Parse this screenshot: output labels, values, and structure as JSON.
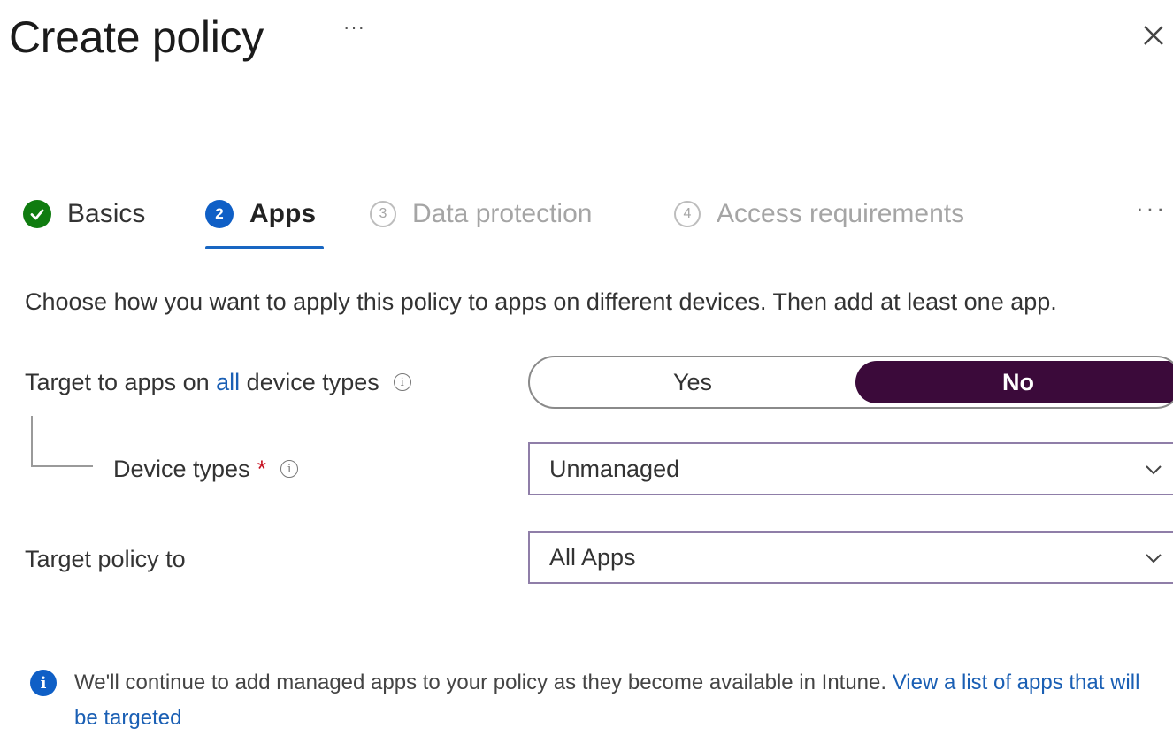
{
  "header": {
    "title": "Create policy",
    "more_label": "···",
    "close_label": "×"
  },
  "stepper": {
    "steps": [
      {
        "label": "Basics",
        "state": "completed",
        "number": ""
      },
      {
        "label": "Apps",
        "state": "current",
        "number": "2"
      },
      {
        "label": "Data protection",
        "state": "pending",
        "number": "3"
      },
      {
        "label": "Access requirements",
        "state": "pending",
        "number": "4"
      }
    ],
    "more_label": "···"
  },
  "description": "Choose how you want to apply this policy to apps on different devices. Then add at least one app.",
  "form": {
    "target_all": {
      "label_prefix": "Target to apps on ",
      "label_link": "all",
      "label_suffix": " device types",
      "yes_label": "Yes",
      "no_label": "No",
      "selected": "No"
    },
    "device_types": {
      "label": "Device types",
      "required_mark": "*",
      "value": "Unmanaged"
    },
    "target_policy": {
      "label": "Target policy to",
      "value": "All Apps"
    }
  },
  "info": {
    "text": "We'll continue to add managed apps to your policy as they become available in Intune. ",
    "link": "View a list of apps that will be targeted"
  },
  "colors": {
    "toggle_selected": "#3b0a3a",
    "step_done": "#107c10",
    "step_active": "#0f5fc6",
    "link": "#1a5fb4",
    "required": "#c50f1f"
  }
}
